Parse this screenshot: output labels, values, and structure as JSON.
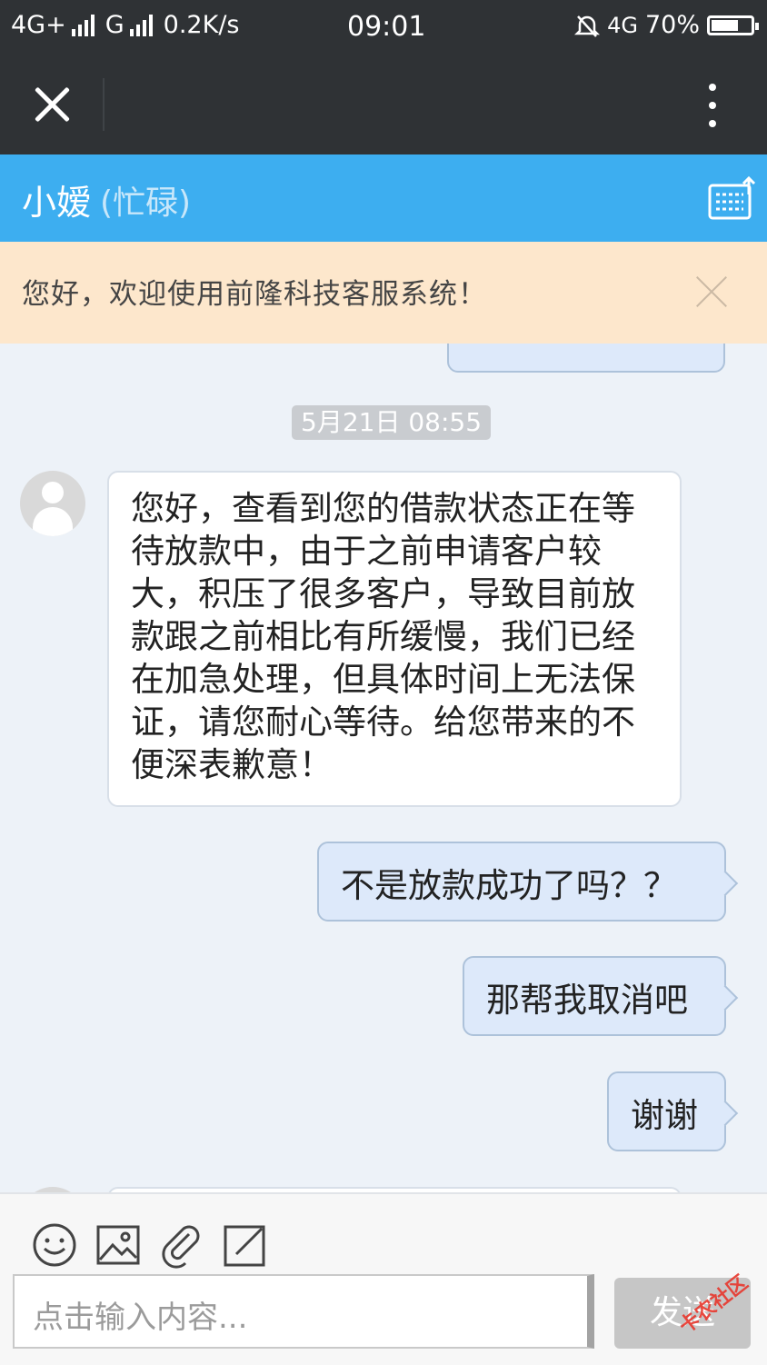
{
  "status_bar": {
    "network1": "4G+",
    "network2": "G",
    "speed": "0.2K/s",
    "time": "09:01",
    "network3": "4G",
    "battery": "70%",
    "battery_level": 0.7
  },
  "chat_header": {
    "agent_name": "小嫒",
    "agent_status": "(忙碌)"
  },
  "notice": {
    "text": "您好，欢迎使用前隆科技客服系统！"
  },
  "chat": {
    "timestamp": "5月21日 08:55",
    "messages": [
      {
        "sender": "agent",
        "text": "您好，查看到您的借款状态正在等待放款中，由于之前申请客户较大，积压了很多客户，导致目前放款跟之前相比有所缓慢，我们已经在加急处理，但具体时间上无法保证，请您耐心等待。给您带来的不便深表歉意！"
      },
      {
        "sender": "user",
        "text": "不是放款成功了吗？？"
      },
      {
        "sender": "user",
        "text": "那帮我取消吧"
      },
      {
        "sender": "user",
        "text": "谢谢"
      }
    ]
  },
  "input": {
    "placeholder": "点击输入内容...",
    "send_label": "发送"
  },
  "watermark": "卡农社区"
}
